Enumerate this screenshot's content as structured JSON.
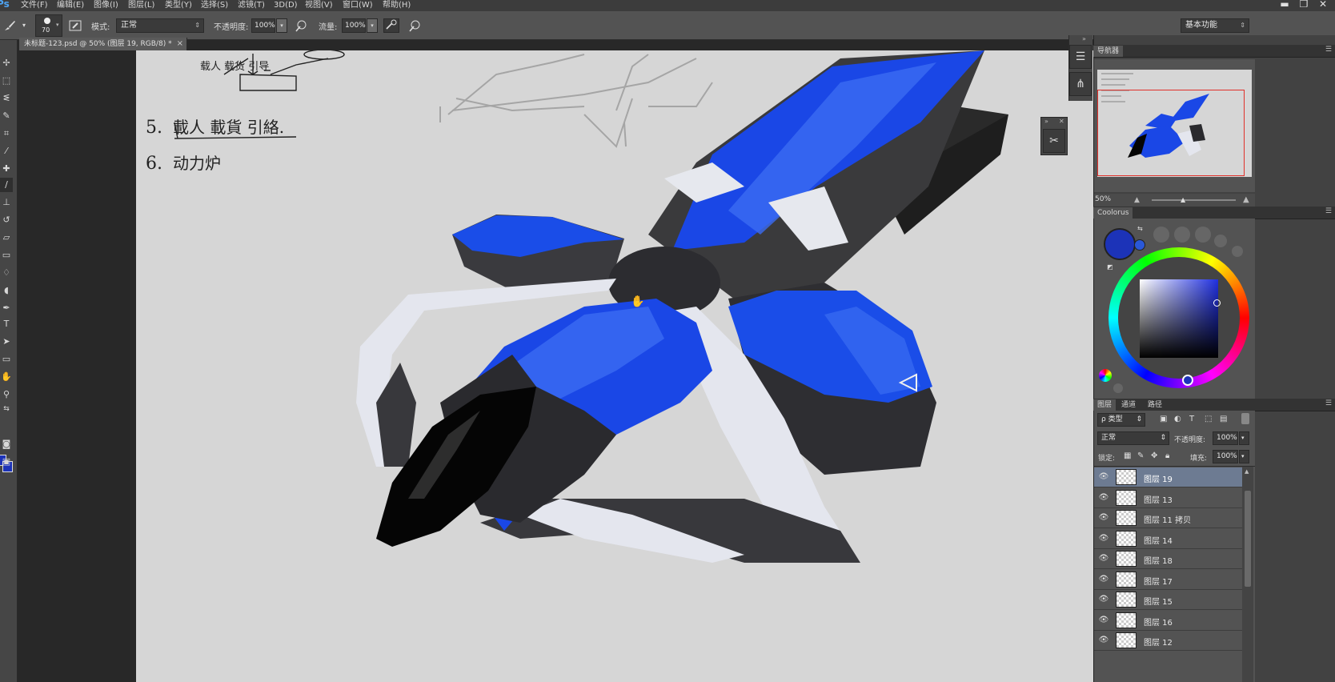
{
  "app": {
    "logo": "Ps"
  },
  "menu": [
    "文件(F)",
    "编辑(E)",
    "图像(I)",
    "图层(L)",
    "类型(Y)",
    "选择(S)",
    "滤镜(T)",
    "3D(D)",
    "视图(V)",
    "窗口(W)",
    "帮助(H)"
  ],
  "window_controls": {
    "minimize": "▬",
    "restore": "❐",
    "close": "✕"
  },
  "options": {
    "brush_size": "70",
    "mode_label": "模式:",
    "mode_value": "正常",
    "opacity_label": "不透明度:",
    "opacity_value": "100%",
    "flow_label": "流量:",
    "flow_value": "100%",
    "workspace": "基本功能"
  },
  "document": {
    "tab_title": "未标题-123.psd @ 50% (图层 19, RGB/8) *",
    "tab_close": "×"
  },
  "canvas_notes": {
    "line5_num": "5.",
    "line5_text": "載人  載貨  引絡.",
    "line6_num": "6.",
    "line6_text": "动力炉",
    "top_scribble": "载人  载货  引导"
  },
  "navigator": {
    "tab_label": "导航器",
    "zoom": "50%"
  },
  "colour": {
    "tab_label": "Coolorus",
    "foreground": "#1c33b8",
    "accent": "#2a58d8"
  },
  "layers_panel": {
    "tabs": [
      "图层",
      "通道",
      "路径"
    ],
    "filter_label": "ρ 类型",
    "blend_mode": "正常",
    "opacity_label": "不透明度:",
    "opacity_value": "100%",
    "lock_label": "锁定:",
    "fill_label": "填充:",
    "fill_value": "100%",
    "layers": [
      {
        "name": "图层 19",
        "selected": true
      },
      {
        "name": "图层 13",
        "selected": false
      },
      {
        "name": "图层 11 拷贝",
        "selected": false
      },
      {
        "name": "图层 14",
        "selected": false
      },
      {
        "name": "图层 18",
        "selected": false
      },
      {
        "name": "图层 17",
        "selected": false
      },
      {
        "name": "图层 15",
        "selected": false
      },
      {
        "name": "图层 16",
        "selected": false
      },
      {
        "name": "图层 12",
        "selected": false
      }
    ]
  },
  "icons": {
    "brush": "brush-icon",
    "hand": "hand-icon",
    "move": "move-icon"
  }
}
